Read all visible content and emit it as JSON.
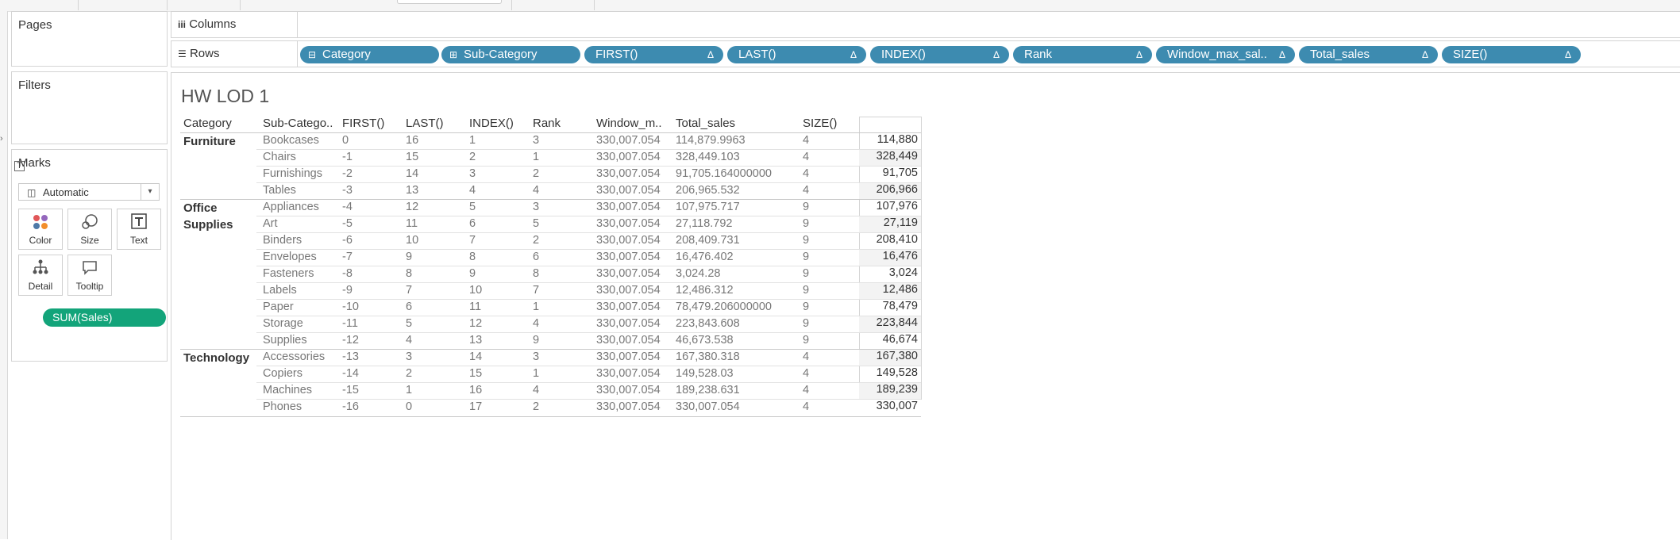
{
  "shelves": {
    "pages_label": "Pages",
    "filters_label": "Filters",
    "columns_label": "Columns",
    "rows_label": "Rows",
    "row_pills": [
      {
        "label": "Category",
        "prefix": "⊟",
        "tri": ""
      },
      {
        "label": "Sub-Category",
        "prefix": "⊞",
        "tri": ""
      },
      {
        "label": "FIRST()",
        "prefix": "",
        "tri": "Δ"
      },
      {
        "label": "LAST()",
        "prefix": "",
        "tri": "Δ"
      },
      {
        "label": "INDEX()",
        "prefix": "",
        "tri": "Δ"
      },
      {
        "label": "Rank",
        "prefix": "",
        "tri": "Δ"
      },
      {
        "label": "Window_max_sal..",
        "prefix": "",
        "tri": "Δ"
      },
      {
        "label": "Total_sales",
        "prefix": "",
        "tri": "Δ"
      },
      {
        "label": "SIZE()",
        "prefix": "",
        "tri": "Δ"
      }
    ]
  },
  "marks": {
    "title": "Marks",
    "type": "Automatic",
    "buttons": [
      {
        "label": "Color",
        "icon": "color-icon"
      },
      {
        "label": "Size",
        "icon": "size-icon"
      },
      {
        "label": "Text",
        "icon": "text-icon"
      },
      {
        "label": "Detail",
        "icon": "detail-icon"
      },
      {
        "label": "Tooltip",
        "icon": "tooltip-icon"
      }
    ],
    "pill": "SUM(Sales)"
  },
  "view": {
    "title": "HW LOD 1",
    "headers": [
      "Category",
      "Sub-Catego..",
      "FIRST()",
      "LAST()",
      "INDEX()",
      "Rank",
      "Window_m..",
      "Total_sales",
      "SIZE()"
    ],
    "groups": [
      {
        "category": [
          "Furniture"
        ],
        "rows": [
          [
            "Bookcases",
            "0",
            "16",
            "1",
            "3",
            "330,007.054",
            "114,879.9963",
            "4",
            "114,880"
          ],
          [
            "Chairs",
            "-1",
            "15",
            "2",
            "1",
            "330,007.054",
            "328,449.103",
            "4",
            "328,449"
          ],
          [
            "Furnishings",
            "-2",
            "14",
            "3",
            "2",
            "330,007.054",
            "91,705.164000000",
            "4",
            "91,705"
          ],
          [
            "Tables",
            "-3",
            "13",
            "4",
            "4",
            "330,007.054",
            "206,965.532",
            "4",
            "206,966"
          ]
        ]
      },
      {
        "category": [
          "Office",
          "Supplies"
        ],
        "rows": [
          [
            "Appliances",
            "-4",
            "12",
            "5",
            "3",
            "330,007.054",
            "107,975.717",
            "9",
            "107,976"
          ],
          [
            "Art",
            "-5",
            "11",
            "6",
            "5",
            "330,007.054",
            "27,118.792",
            "9",
            "27,119"
          ],
          [
            "Binders",
            "-6",
            "10",
            "7",
            "2",
            "330,007.054",
            "208,409.731",
            "9",
            "208,410"
          ],
          [
            "Envelopes",
            "-7",
            "9",
            "8",
            "6",
            "330,007.054",
            "16,476.402",
            "9",
            "16,476"
          ],
          [
            "Fasteners",
            "-8",
            "8",
            "9",
            "8",
            "330,007.054",
            "3,024.28",
            "9",
            "3,024"
          ],
          [
            "Labels",
            "-9",
            "7",
            "10",
            "7",
            "330,007.054",
            "12,486.312",
            "9",
            "12,486"
          ],
          [
            "Paper",
            "-10",
            "6",
            "11",
            "1",
            "330,007.054",
            "78,479.206000000",
            "9",
            "78,479"
          ],
          [
            "Storage",
            "-11",
            "5",
            "12",
            "4",
            "330,007.054",
            "223,843.608",
            "9",
            "223,844"
          ],
          [
            "Supplies",
            "-12",
            "4",
            "13",
            "9",
            "330,007.054",
            "46,673.538",
            "9",
            "46,674"
          ]
        ]
      },
      {
        "category": [
          "Technology"
        ],
        "rows": [
          [
            "Accessories",
            "-13",
            "3",
            "14",
            "3",
            "330,007.054",
            "167,380.318",
            "4",
            "167,380"
          ],
          [
            "Copiers",
            "-14",
            "2",
            "15",
            "1",
            "330,007.054",
            "149,528.03",
            "4",
            "149,528"
          ],
          [
            "Machines",
            "-15",
            "1",
            "16",
            "4",
            "330,007.054",
            "189,238.631",
            "4",
            "189,239"
          ],
          [
            "Phones",
            "-16",
            "0",
            "17",
            "2",
            "330,007.054",
            "330,007.054",
            "4",
            "330,007"
          ]
        ]
      }
    ]
  }
}
